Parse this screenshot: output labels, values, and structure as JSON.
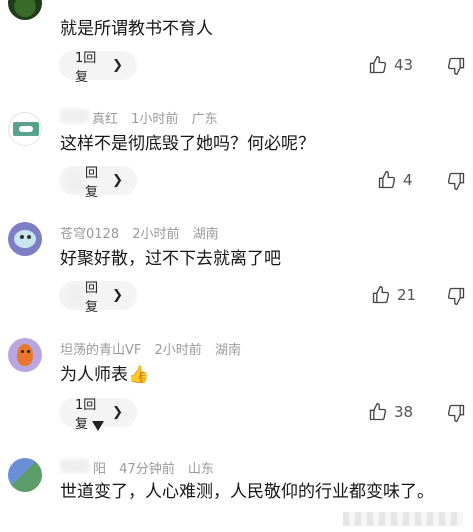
{
  "comments": [
    {
      "author": "",
      "time": "",
      "location": "",
      "text": "就是所谓教书不育人",
      "reply_label": "1回复",
      "likes": "43"
    },
    {
      "author": "真红",
      "time": "1小时前",
      "location": "广东",
      "text": "这样不是彻底毁了她吗？何必呢？",
      "reply_label": "回复",
      "likes": "4"
    },
    {
      "author": "苍穹0128",
      "time": "2小时前",
      "location": "湖南",
      "text": "好聚好散，过不下去就离了吧",
      "reply_label": "回复",
      "likes": "21"
    },
    {
      "author": "坦荡的青山VF",
      "time": "2小时前",
      "location": "湖南",
      "text": "为人师表👍",
      "reply_label": "1回复",
      "likes": "38"
    },
    {
      "author": "阳",
      "time": "47分钟前",
      "location": "山东",
      "text": "世道变了，人心难测，人民敬仰的行业都变味了。",
      "reply_label": "",
      "likes": ""
    }
  ],
  "icons": {
    "like": "thumbs-up-icon",
    "dislike": "thumbs-down-icon",
    "reply_arrow": "chevron-right-icon"
  },
  "colors": {
    "meta": "#9a9a9a",
    "reply_bg": "#f4f4f4"
  }
}
